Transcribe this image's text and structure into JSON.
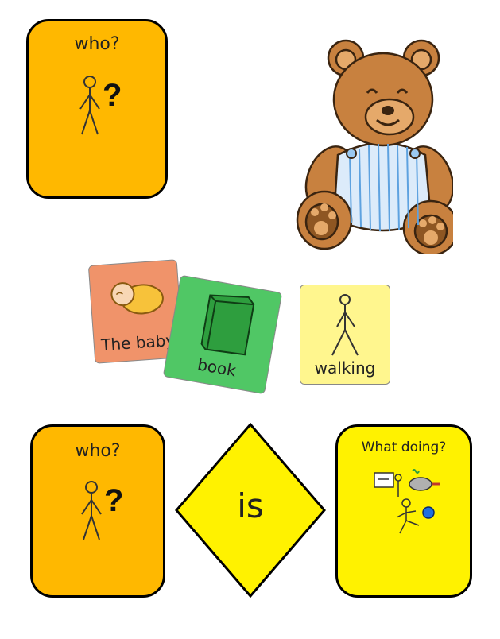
{
  "cards": {
    "top_who": {
      "label": "who?",
      "color": "#FFB800",
      "icon": "person-question-icon"
    },
    "bottom_who": {
      "label": "who?",
      "color": "#FFB800",
      "icon": "person-question-icon"
    },
    "is_diamond": {
      "label": "is",
      "color": "#FFF200"
    },
    "what_doing": {
      "label": "What doing?",
      "color": "#FFF200",
      "icons": [
        "writing-icon",
        "cooking-icon",
        "kicking-ball-icon"
      ]
    }
  },
  "mini_cards": {
    "baby": {
      "label": "The baby",
      "color": "#F0936A",
      "icon": "sleeping-baby-icon"
    },
    "book": {
      "label": "book",
      "color": "#50C765",
      "icon": "green-book-icon"
    },
    "walking": {
      "label": "walking",
      "color": "#FFF68E",
      "icon": "walking-person-icon"
    }
  },
  "illustration": {
    "name": "teddy-bear"
  },
  "glyphs": {
    "question": "?"
  }
}
